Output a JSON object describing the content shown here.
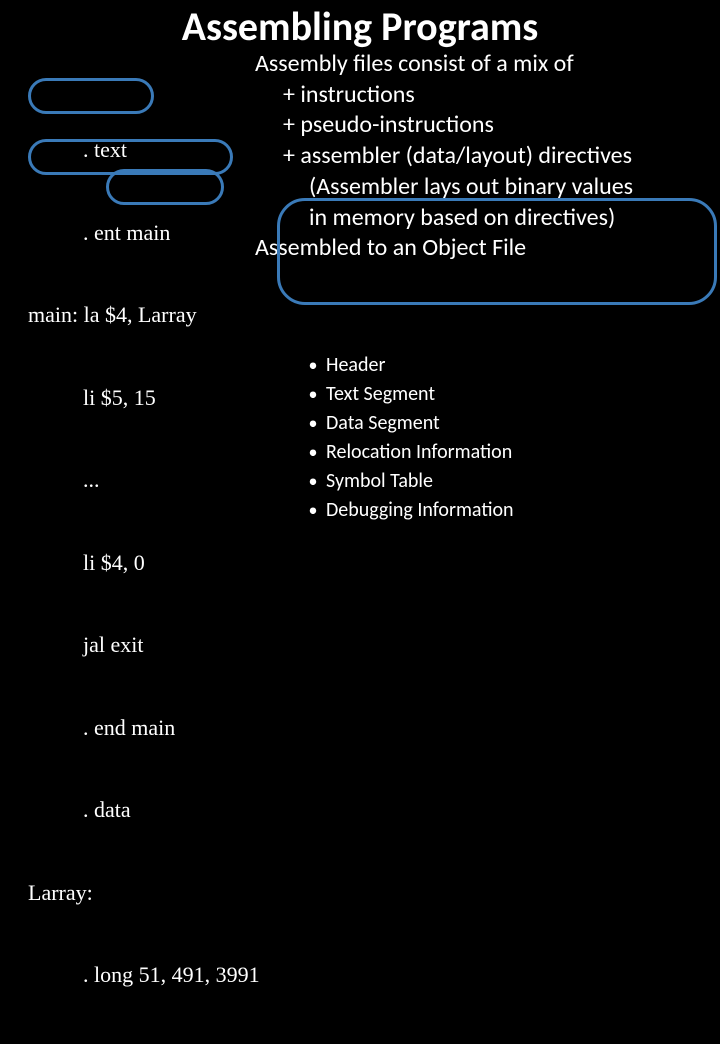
{
  "title": "Assembling Programs",
  "code": {
    "l0": "          . text",
    "l1": "          . ent main",
    "l2": "main: la $4, Larray",
    "l3": "          li $5, 15",
    "l4": "          ...",
    "l5": "          li $4, 0",
    "l6": "          jal exit",
    "l7": "          . end main",
    "l8": "          . data",
    "l9": "Larray:",
    "l10": "          . long 51, 491, 3991"
  },
  "right": {
    "r0": "Assembly files consist of a mix of",
    "r1": "+ instructions",
    "r2": "+ pseudo-instructions",
    "r3": "+ assembler (data/layout) directives",
    "r4": "(Assembler lays out binary values",
    "r5": "in memory based on directives)",
    "r6": "Assembled to an Object File"
  },
  "objfile": {
    "b0": "Header",
    "b1": "Text Segment",
    "b2": "Data Segment",
    "b3": "Relocation Information",
    "b4": "Symbol Table",
    "b5": "Debugging Information"
  }
}
